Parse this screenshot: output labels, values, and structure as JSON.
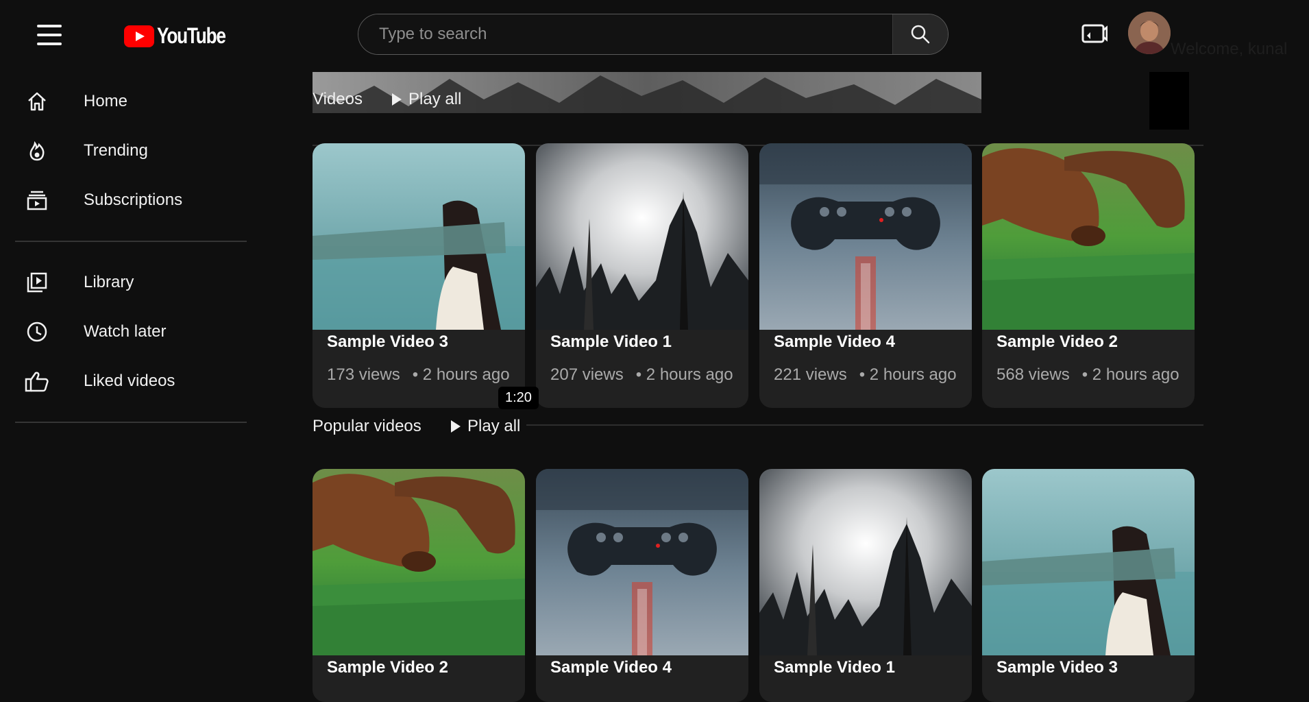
{
  "header": {
    "logo_text": "YouTube",
    "search_placeholder": "Type to search",
    "welcome_text": "Welcome, kunal"
  },
  "sidebar": {
    "items": [
      {
        "label": "Home",
        "icon": "home-icon"
      },
      {
        "label": "Trending",
        "icon": "flame-icon"
      },
      {
        "label": "Subscriptions",
        "icon": "subscriptions-icon"
      },
      {
        "label": "Library",
        "icon": "library-icon"
      },
      {
        "label": "Watch later",
        "icon": "clock-icon"
      },
      {
        "label": "Liked videos",
        "icon": "thumbs-up-icon"
      }
    ]
  },
  "shelves": [
    {
      "title": "Videos",
      "play_all": "Play all",
      "videos": [
        {
          "title": "Sample Video 3",
          "views": "173 views",
          "age": "• 2 hours ago",
          "thumb": "blindfold-woman"
        },
        {
          "title": "Sample Video 1",
          "views": "207 views",
          "age": "• 2 hours ago",
          "thumb": "misty-forest"
        },
        {
          "title": "Sample Video 4",
          "views": "221 views",
          "age": "• 2 hours ago",
          "thumb": "game-controller"
        },
        {
          "title": "Sample Video 2",
          "views": "568 views",
          "age": "• 2 hours ago",
          "thumb": "dogs-grass"
        }
      ]
    },
    {
      "title": "Popular videos",
      "play_all": "Play all",
      "videos": [
        {
          "title": "Sample Video 2",
          "thumb": "dogs-grass"
        },
        {
          "title": "Sample Video 4",
          "thumb": "game-controller"
        },
        {
          "title": "Sample Video 1",
          "thumb": "misty-forest"
        },
        {
          "title": "Sample Video 3",
          "thumb": "blindfold-woman"
        }
      ]
    }
  ],
  "duration_badge": "1:20",
  "colors": {
    "background": "#0f0f0f",
    "card": "#212121",
    "brand_red": "#ff0000",
    "meta_text": "#aaaaaa"
  }
}
